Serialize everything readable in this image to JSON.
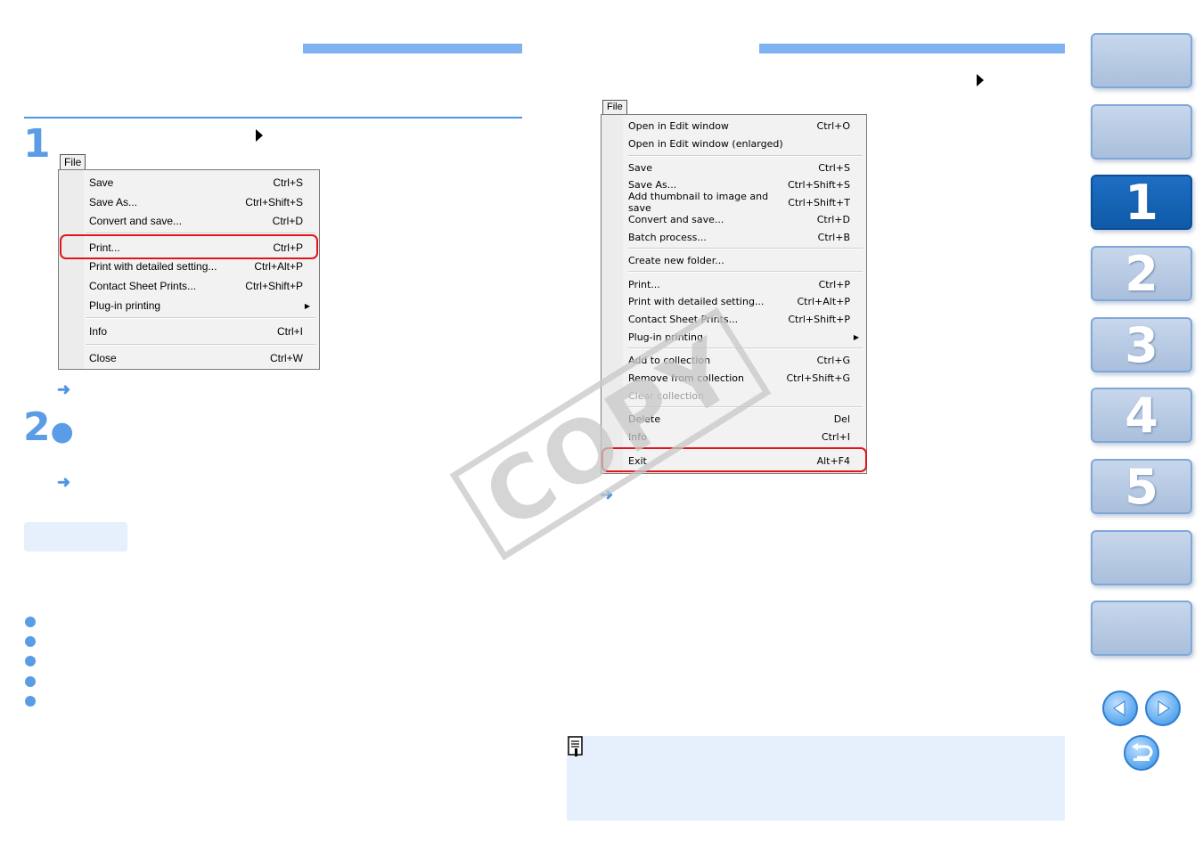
{
  "steps": {
    "step1_number": "1",
    "step2_number": "2"
  },
  "left_menu": {
    "file_tab": "File",
    "items": [
      {
        "label": "Save",
        "shortcut": "Ctrl+S"
      },
      {
        "label": "Save As...",
        "shortcut": "Ctrl+Shift+S"
      },
      {
        "label": "Convert and save...",
        "shortcut": "Ctrl+D"
      },
      {
        "label": "Print...",
        "shortcut": "Ctrl+P"
      },
      {
        "label": "Print with detailed setting...",
        "shortcut": "Ctrl+Alt+P"
      },
      {
        "label": "Contact Sheet Prints...",
        "shortcut": "Ctrl+Shift+P"
      },
      {
        "label": "Plug-in printing",
        "shortcut": ""
      },
      {
        "label": "Info",
        "shortcut": "Ctrl+I"
      },
      {
        "label": "Close",
        "shortcut": "Ctrl+W"
      }
    ],
    "highlighted": "Print..."
  },
  "right_menu": {
    "file_tab": "File",
    "items": [
      {
        "label": "Open in Edit window",
        "shortcut": "Ctrl+O"
      },
      {
        "label": "Open in Edit window (enlarged)",
        "shortcut": ""
      },
      {
        "label": "Save",
        "shortcut": "Ctrl+S"
      },
      {
        "label": "Save As...",
        "shortcut": "Ctrl+Shift+S"
      },
      {
        "label": "Add thumbnail to image and save",
        "shortcut": "Ctrl+Shift+T"
      },
      {
        "label": "Convert and save...",
        "shortcut": "Ctrl+D"
      },
      {
        "label": "Batch process...",
        "shortcut": "Ctrl+B"
      },
      {
        "label": "Create new folder...",
        "shortcut": ""
      },
      {
        "label": "Print...",
        "shortcut": "Ctrl+P"
      },
      {
        "label": "Print with detailed setting...",
        "shortcut": "Ctrl+Alt+P"
      },
      {
        "label": "Contact Sheet Prints...",
        "shortcut": "Ctrl+Shift+P"
      },
      {
        "label": "Plug-in printing",
        "shortcut": ""
      },
      {
        "label": "Add to collection",
        "shortcut": "Ctrl+G"
      },
      {
        "label": "Remove from collection",
        "shortcut": "Ctrl+Shift+G"
      },
      {
        "label": "Clear collection",
        "shortcut": ""
      },
      {
        "label": "Delete",
        "shortcut": "Del"
      },
      {
        "label": "Info",
        "shortcut": "Ctrl+I"
      },
      {
        "label": "Exit",
        "shortcut": "Alt+F4"
      }
    ],
    "highlighted": "Exit"
  },
  "watermark": "COPY",
  "chapter_tabs": [
    {
      "label": ""
    },
    {
      "label": ""
    },
    {
      "label": "1"
    },
    {
      "label": "2"
    },
    {
      "label": "3"
    },
    {
      "label": "4"
    },
    {
      "label": "5"
    },
    {
      "label": ""
    },
    {
      "label": ""
    }
  ],
  "active_chapter": "1",
  "colors": {
    "accent": "#7fb2f0",
    "rule": "#4e95e6",
    "highlight_red": "#e0161e",
    "active_tab": "#1e6ec4"
  },
  "icons": {
    "prev": "prev-page-icon",
    "next": "next-page-icon",
    "back": "return-icon",
    "note": "memo-icon"
  }
}
